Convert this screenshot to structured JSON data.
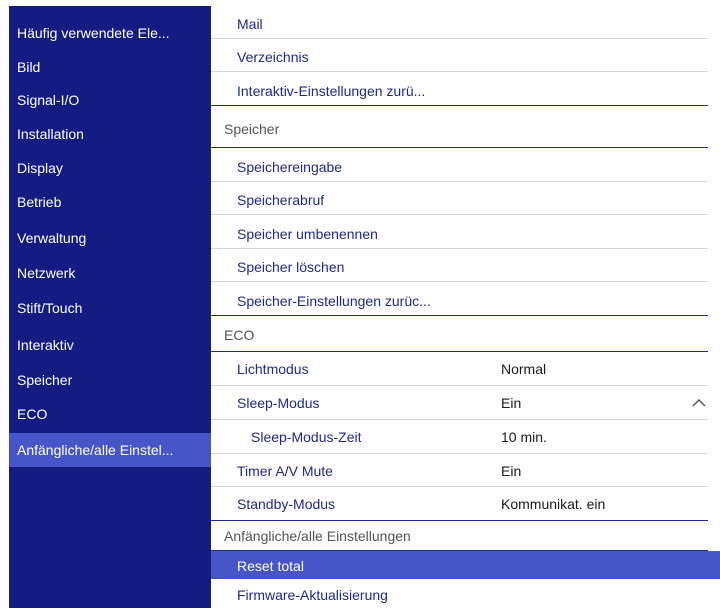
{
  "sidebar": {
    "items": [
      {
        "label": "Häufig verwendete Ele..."
      },
      {
        "label": "Bild"
      },
      {
        "label": "Signal-I/O"
      },
      {
        "label": "Installation"
      },
      {
        "label": "Display"
      },
      {
        "label": "Betrieb"
      },
      {
        "label": "Verwaltung"
      },
      {
        "label": "Netzwerk"
      },
      {
        "label": "Stift/Touch"
      },
      {
        "label": "Interaktiv"
      },
      {
        "label": "Speicher"
      },
      {
        "label": "ECO"
      },
      {
        "label": "Anfängliche/alle Einstel...",
        "selected": true
      }
    ]
  },
  "main": {
    "interaktiv_items": [
      {
        "label": "Mail"
      },
      {
        "label": "Verzeichnis"
      },
      {
        "label": "Interaktiv-Einstellungen zurü..."
      }
    ],
    "speicher": {
      "header": "Speicher",
      "items": [
        {
          "label": "Speichereingabe"
        },
        {
          "label": "Speicherabruf"
        },
        {
          "label": "Speicher umbenennen"
        },
        {
          "label": "Speicher löschen"
        },
        {
          "label": "Speicher-Einstellungen zurüc..."
        }
      ]
    },
    "eco": {
      "header": "ECO",
      "items": [
        {
          "label": "Lichtmodus",
          "value": "Normal"
        },
        {
          "label": "Sleep-Modus",
          "value": "Ein",
          "expanded": true
        },
        {
          "label": "Sleep-Modus-Zeit",
          "value": "10 min."
        },
        {
          "label": "Timer A/V Mute",
          "value": "Ein"
        },
        {
          "label": "Standby-Modus",
          "value": "Kommunikat. ein"
        }
      ]
    },
    "anfaengliche": {
      "header": "Anfängliche/alle Einstellungen",
      "items": [
        {
          "label": "Reset total",
          "selected": true
        },
        {
          "label": "Firmware-Aktualisierung"
        }
      ]
    }
  },
  "colors": {
    "sidebar_bg": "#141c82",
    "selection": "#4656c8",
    "item_text": "#1f2a8a",
    "header_text": "#555555"
  }
}
